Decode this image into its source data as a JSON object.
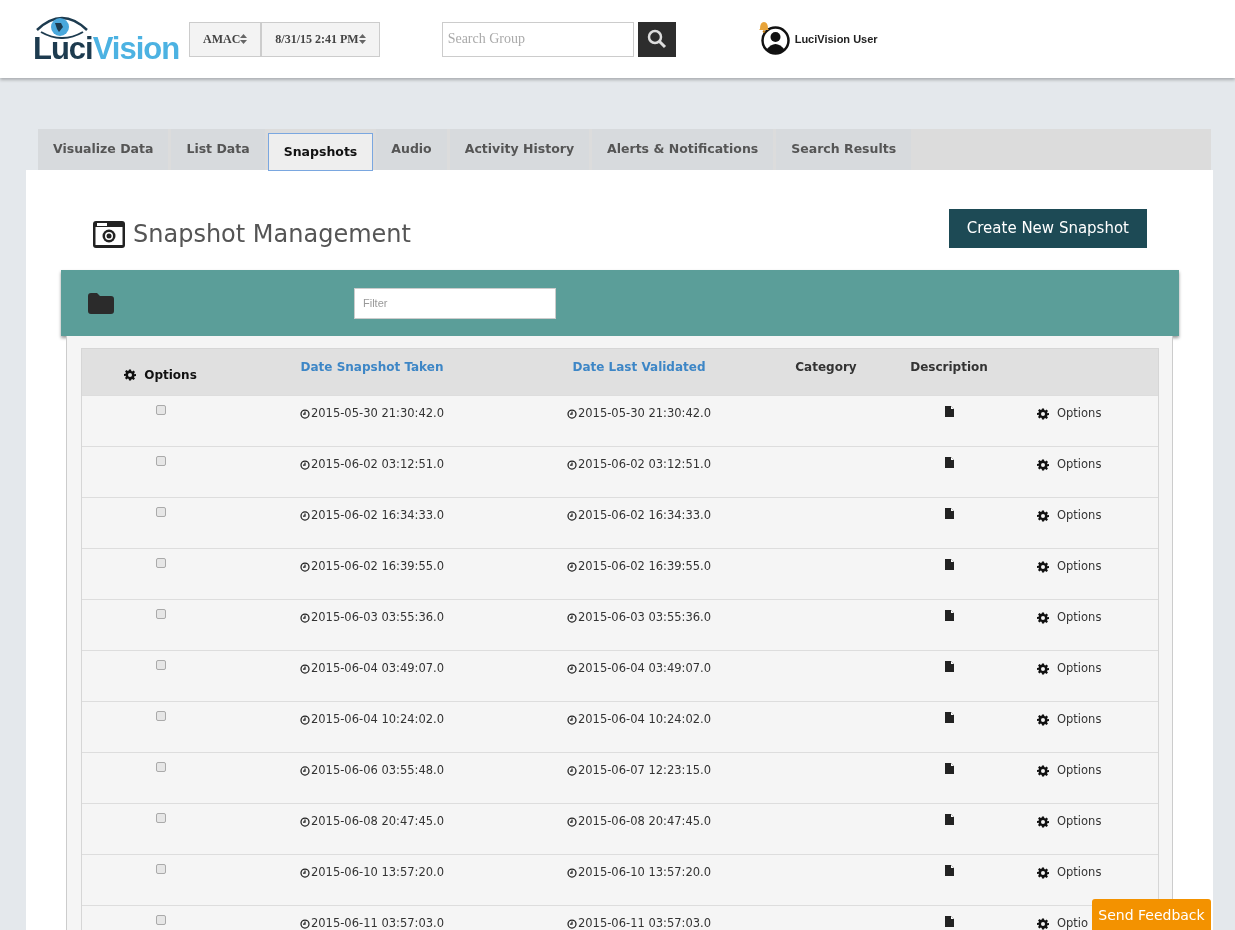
{
  "header": {
    "logo": {
      "part_1": "Luci",
      "part_2": "Vision"
    },
    "group_select": "AMAC",
    "date_select": "8/31/15 2:41 PM",
    "search": {
      "placeholder": "Search Group"
    },
    "user_name": "LuciVision User"
  },
  "tabs": [
    {
      "label": "Visualize Data",
      "selected": false
    },
    {
      "label": "List Data",
      "selected": false
    },
    {
      "label": "Snapshots",
      "selected": true
    },
    {
      "label": "Audio",
      "selected": false
    },
    {
      "label": "Activity History",
      "selected": false
    },
    {
      "label": "Alerts & Notifications",
      "selected": false
    },
    {
      "label": "Search Results",
      "selected": false
    }
  ],
  "page_title": "Snapshot Management",
  "create_button": "Create New Snapshot",
  "filter": {
    "placeholder": "Filter"
  },
  "table": {
    "columns": [
      {
        "label": "Options",
        "kind": "options"
      },
      {
        "label": "Date Snapshot Taken",
        "kind": "sortable"
      },
      {
        "label": "Date Last Validated",
        "kind": "sortable"
      },
      {
        "label": "Category",
        "kind": "plain"
      },
      {
        "label": "Description",
        "kind": "plain"
      }
    ],
    "rows": [
      {
        "checked": false,
        "taken": "2015-05-30 21:30:42.0",
        "validated": "2015-05-30 21:30:42.0",
        "options": "Options"
      },
      {
        "checked": false,
        "taken": "2015-06-02 03:12:51.0",
        "validated": "2015-06-02 03:12:51.0",
        "options": "Options"
      },
      {
        "checked": false,
        "taken": "2015-06-02 16:34:33.0",
        "validated": "2015-06-02 16:34:33.0",
        "options": "Options"
      },
      {
        "checked": false,
        "taken": "2015-06-02 16:39:55.0",
        "validated": "2015-06-02 16:39:55.0",
        "options": "Options"
      },
      {
        "checked": false,
        "taken": "2015-06-03 03:55:36.0",
        "validated": "2015-06-03 03:55:36.0",
        "options": "Options"
      },
      {
        "checked": false,
        "taken": "2015-06-04 03:49:07.0",
        "validated": "2015-06-04 03:49:07.0",
        "options": "Options"
      },
      {
        "checked": false,
        "taken": "2015-06-04 10:24:02.0",
        "validated": "2015-06-04 10:24:02.0",
        "options": "Options"
      },
      {
        "checked": false,
        "taken": "2015-06-06 03:55:48.0",
        "validated": "2015-06-07 12:23:15.0",
        "options": "Options"
      },
      {
        "checked": false,
        "taken": "2015-06-08 20:47:45.0",
        "validated": "2015-06-08 20:47:45.0",
        "options": "Options"
      },
      {
        "checked": false,
        "taken": "2015-06-10 13:57:20.0",
        "validated": "2015-06-10 13:57:20.0",
        "options": "Options"
      },
      {
        "checked": false,
        "taken": "2015-06-11 03:57:03.0",
        "validated": "2015-06-11 03:57:03.0",
        "options": "Optio"
      }
    ]
  },
  "feedback_button": "Send Feedback"
}
